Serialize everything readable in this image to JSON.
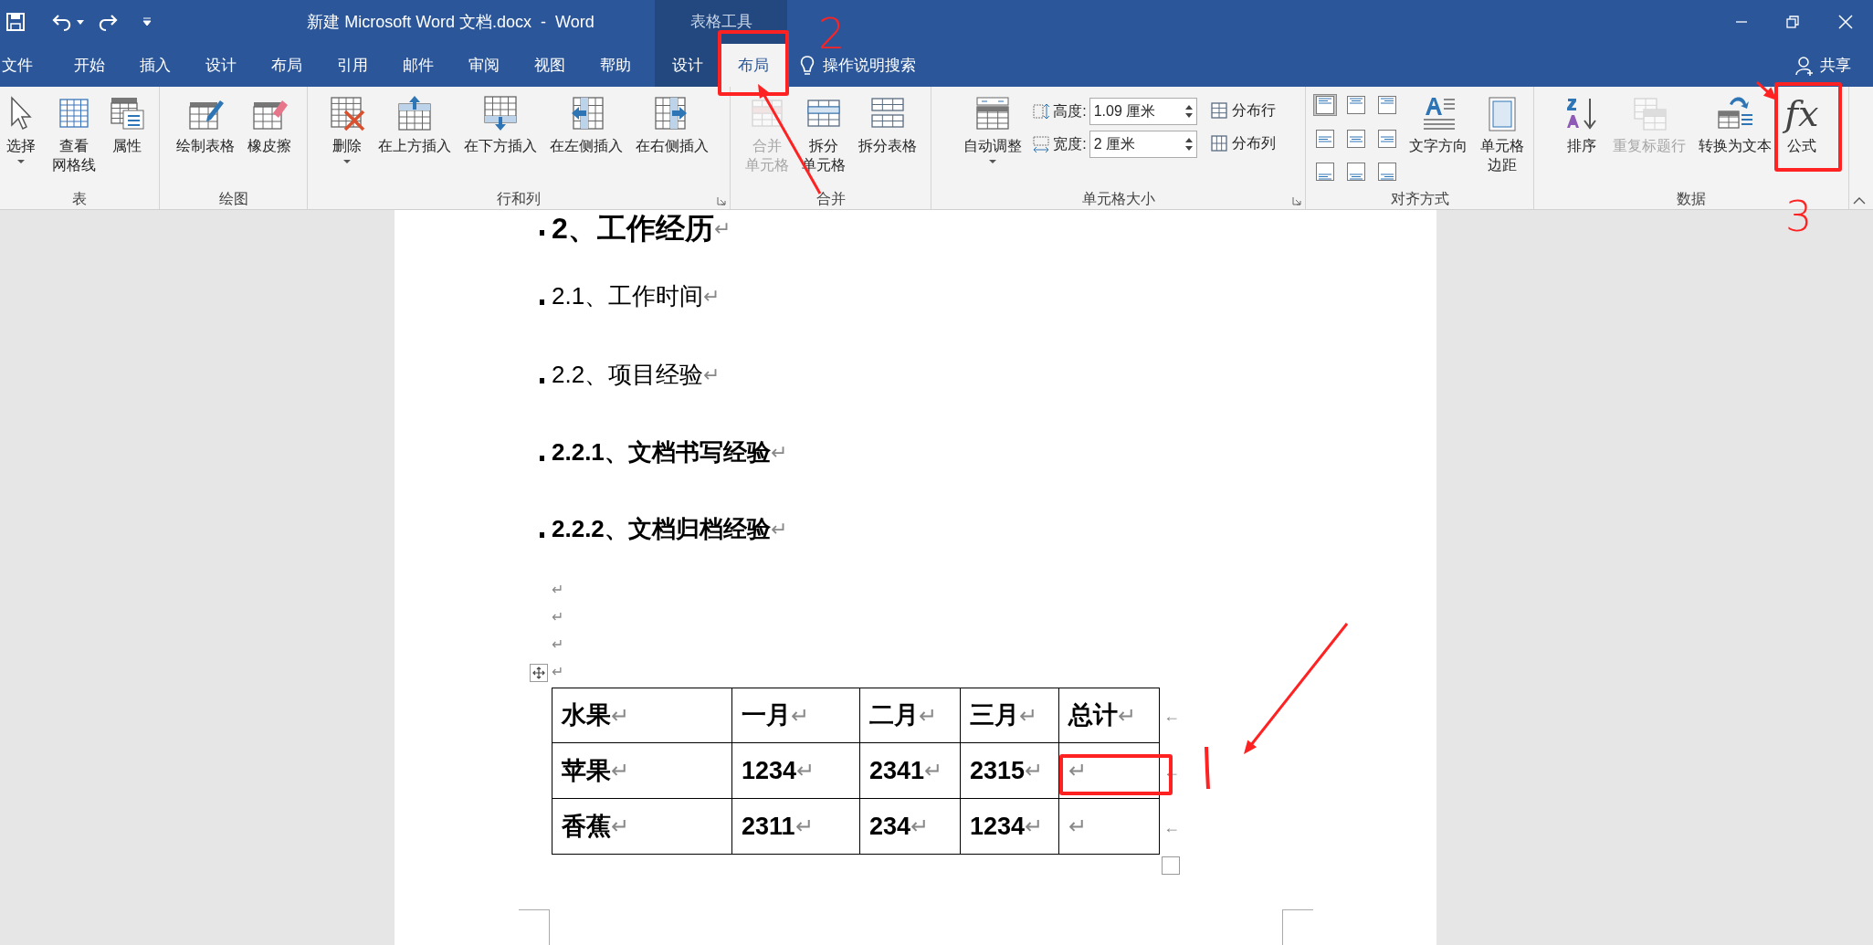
{
  "title_bar": {
    "title": "新建 Microsoft Word 文档.docx  -  Word",
    "context_label": "表格工具"
  },
  "tabs": [
    {
      "label": "文件",
      "selected": false,
      "contextual": false
    },
    {
      "label": "开始",
      "selected": false,
      "contextual": false
    },
    {
      "label": "插入",
      "selected": false,
      "contextual": false
    },
    {
      "label": "设计",
      "selected": false,
      "contextual": false
    },
    {
      "label": "布局",
      "selected": false,
      "contextual": false
    },
    {
      "label": "引用",
      "selected": false,
      "contextual": false
    },
    {
      "label": "邮件",
      "selected": false,
      "contextual": false
    },
    {
      "label": "审阅",
      "selected": false,
      "contextual": false
    },
    {
      "label": "视图",
      "selected": false,
      "contextual": false
    },
    {
      "label": "帮助",
      "selected": false,
      "contextual": false
    },
    {
      "label": "设计",
      "selected": false,
      "contextual": true
    },
    {
      "label": "布局",
      "selected": true,
      "contextual": true
    }
  ],
  "tell_me": "操作说明搜索",
  "share": "共享",
  "ribbon_groups": [
    {
      "label": "表",
      "items": [
        {
          "kind": "large",
          "lines": [
            "选择"
          ],
          "dropdown": true,
          "disabled": false
        },
        {
          "kind": "large",
          "lines": [
            "查看",
            "网格线"
          ],
          "dropdown": false,
          "disabled": false
        },
        {
          "kind": "large",
          "lines": [
            "属性"
          ],
          "dropdown": false,
          "disabled": false
        }
      ]
    },
    {
      "label": "绘图",
      "items": [
        {
          "kind": "large",
          "lines": [
            "绘制表格"
          ],
          "dropdown": false,
          "disabled": false
        },
        {
          "kind": "large",
          "lines": [
            "橡皮擦"
          ],
          "dropdown": false,
          "disabled": false
        }
      ]
    },
    {
      "label": "行和列",
      "launcher": true,
      "items": [
        {
          "kind": "large",
          "lines": [
            "删除"
          ],
          "dropdown": true,
          "disabled": false
        },
        {
          "kind": "large",
          "lines": [
            "在上方插入"
          ],
          "dropdown": false,
          "disabled": false
        },
        {
          "kind": "large",
          "lines": [
            "在下方插入"
          ],
          "dropdown": false,
          "disabled": false
        },
        {
          "kind": "large",
          "lines": [
            "在左侧插入"
          ],
          "dropdown": false,
          "disabled": false
        },
        {
          "kind": "large",
          "lines": [
            "在右侧插入"
          ],
          "dropdown": false,
          "disabled": false
        }
      ]
    },
    {
      "label": "合并",
      "items": [
        {
          "kind": "large",
          "lines": [
            "合并",
            "单元格"
          ],
          "dropdown": false,
          "disabled": true
        },
        {
          "kind": "large",
          "lines": [
            "拆分",
            "单元格"
          ],
          "dropdown": false,
          "disabled": false
        },
        {
          "kind": "large",
          "lines": [
            "拆分表格"
          ],
          "dropdown": false,
          "disabled": false
        }
      ]
    },
    {
      "label": "单元格大小",
      "launcher": true,
      "items": [
        {
          "kind": "large",
          "lines": [
            "自动调整"
          ],
          "dropdown": true,
          "disabled": false
        },
        {
          "kind": "spins",
          "fields": [
            {
              "label": "高度:",
              "value": "1.09 厘米"
            },
            {
              "label": "宽度:",
              "value": "2 厘米"
            }
          ]
        },
        {
          "kind": "smalls",
          "buttons": [
            {
              "label": "分布行"
            },
            {
              "label": "分布列"
            }
          ]
        }
      ]
    },
    {
      "label": "对齐方式",
      "items": [
        {
          "kind": "align_grid",
          "buttons": [
            {
              "selected": true
            },
            {
              "selected": false
            },
            {
              "selected": false
            },
            {
              "selected": false
            },
            {
              "selected": false
            },
            {
              "selected": false
            },
            {
              "selected": false
            },
            {
              "selected": false
            },
            {
              "selected": false
            }
          ]
        },
        {
          "kind": "large",
          "lines": [
            "文字方向"
          ],
          "dropdown": false,
          "disabled": false
        },
        {
          "kind": "large",
          "lines": [
            "单元格",
            "边距"
          ],
          "dropdown": false,
          "disabled": false
        }
      ]
    },
    {
      "label": "数据",
      "items": [
        {
          "kind": "large",
          "lines": [
            "排序"
          ],
          "dropdown": false,
          "disabled": false
        },
        {
          "kind": "large",
          "lines": [
            "重复标题行"
          ],
          "dropdown": false,
          "disabled": true
        },
        {
          "kind": "large",
          "lines": [
            "转换为文本"
          ],
          "dropdown": false,
          "disabled": false
        },
        {
          "kind": "large",
          "lines": [
            "公式"
          ],
          "dropdown": false,
          "disabled": false,
          "glyph": "fx"
        }
      ]
    }
  ],
  "document": {
    "paragraphs": [
      {
        "kind": "h2",
        "text": "2、工作经历",
        "end_mark": "↵"
      },
      {
        "kind": "h3",
        "text": "2.1、工作时间",
        "end_mark": "↵"
      },
      {
        "kind": "h3",
        "text": "2.2、项目经验",
        "end_mark": "↵"
      },
      {
        "kind": "h4",
        "text": "2.2.1、文档书写经验",
        "end_mark": "↵"
      },
      {
        "kind": "h4",
        "text": "2.2.2、文档归档经验",
        "end_mark": "↵"
      },
      {
        "kind": "normal",
        "end_mark": "↵"
      },
      {
        "kind": "normal",
        "end_mark": "↵"
      },
      {
        "kind": "normal",
        "end_mark": "↵"
      },
      {
        "kind": "normal",
        "end_mark": "↵"
      }
    ],
    "table": {
      "rows": [
        {
          "end_mark": "←",
          "cells": [
            {
              "text": "水果",
              "end_mark": "↵"
            },
            {
              "text": "一月",
              "end_mark": "↵"
            },
            {
              "text": "二月",
              "end_mark": "↵"
            },
            {
              "text": "三月",
              "end_mark": "↵"
            },
            {
              "text": "总计",
              "end_mark": "↵"
            }
          ]
        },
        {
          "end_mark": "←",
          "cells": [
            {
              "text": "苹果",
              "end_mark": "↵"
            },
            {
              "text": "1234",
              "end_mark": "↵"
            },
            {
              "text": "2341",
              "end_mark": "↵"
            },
            {
              "text": "2315",
              "end_mark": "↵"
            },
            {
              "end_mark": "↵"
            }
          ]
        },
        {
          "end_mark": "←",
          "cells": [
            {
              "text": "香蕉",
              "end_mark": "↵"
            },
            {
              "text": "2311",
              "end_mark": "↵"
            },
            {
              "text": "234",
              "end_mark": "↵"
            },
            {
              "text": "1234",
              "end_mark": "↵"
            },
            {
              "end_mark": "↵"
            }
          ]
        }
      ]
    }
  },
  "annotations": {
    "step_labels": [
      "2",
      "3"
    ]
  }
}
